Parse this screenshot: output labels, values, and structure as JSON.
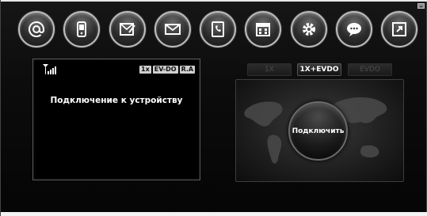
{
  "toolbar": {
    "buttons": [
      {
        "icon": "at-sign-icon"
      },
      {
        "icon": "phone-icon"
      },
      {
        "icon": "compose-message-icon"
      },
      {
        "icon": "envelope-icon"
      },
      {
        "icon": "phonebook-icon"
      },
      {
        "icon": "calendar-icon"
      },
      {
        "icon": "gear-icon"
      },
      {
        "icon": "speech-bubble-icon"
      },
      {
        "icon": "exit-icon"
      }
    ]
  },
  "status": {
    "network_tags": [
      "1x",
      "EV-DO",
      "R.A"
    ],
    "message": "Подключение к устройству"
  },
  "network_modes": {
    "options": [
      "1X",
      "1X+EVDO",
      "EVDO"
    ],
    "selected": "1X+EVDO"
  },
  "connect": {
    "label": "Подключить"
  },
  "colors": {
    "background": "#0a0a0a",
    "ring": "#bdbdbd",
    "text": "#ffffff",
    "tag_bg": "#cfcfcf"
  }
}
